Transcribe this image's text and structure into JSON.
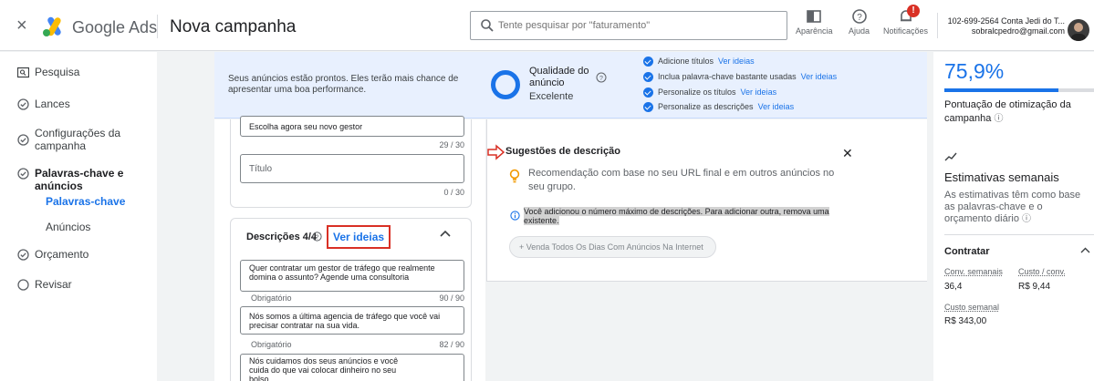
{
  "topbar": {
    "brand": "Google Ads",
    "page_title": "Nova campanha",
    "search_placeholder": "Tente pesquisar por \"faturamento\"",
    "tools": [
      "Aparência",
      "Ajuda",
      "Notificações"
    ],
    "notification_count": "!",
    "account_id": "102-699-2564 Conta Jedi do T...",
    "account_email": "sobralcpedro@gmail.com"
  },
  "nav": {
    "items": [
      "Pesquisa",
      "Lances",
      "Configurações da campanha",
      "Palavras-chave e anúncios",
      "Orçamento",
      "Revisar"
    ],
    "subitems": [
      "Palavras-chave",
      "Anúncios"
    ]
  },
  "banner": {
    "message": "Seus anúncios estão prontos. Eles terão mais chance de apresentar uma boa performance.",
    "quality_label": "Qualidade do anúncio",
    "quality_value": "Excelente",
    "checklist": [
      {
        "text": "Adicione títulos",
        "link": "Ver ideias"
      },
      {
        "text": "Inclua palavra-chave bastante usadas",
        "link": "Ver ideias"
      },
      {
        "text": "Personalize os títulos",
        "link": "Ver ideias"
      },
      {
        "text": "Personalize as descrições",
        "link": "Ver ideias"
      }
    ]
  },
  "editor": {
    "headline_value": "Escolha agora seu novo gestor",
    "headline_count": "29 / 30",
    "headline_placeholder": "Título",
    "empty_count": "0 / 30",
    "descriptions_title": "Descrições 4/4",
    "see_ideas": "Ver ideias",
    "required_label": "Obrigatório",
    "descriptions": [
      {
        "text": "Quer contratar um gestor de tráfego que realmente domina o assunto? Agende uma consultoria",
        "count": "90 / 90"
      },
      {
        "text": "Nós somos a última agencia de tráfego que você vai precisar contratar na sua vida.",
        "count": "82 / 90"
      },
      {
        "text": "Nós cuidamos dos seus anúncios e você cuida do que vai colocar dinheiro no seu bolso.",
        "count": ""
      }
    ]
  },
  "suggestions": {
    "title": "Sugestões de descrição",
    "recommendation": "Recomendação com base no seu URL final e em outros anúncios no seu grupo.",
    "warning": "Você adicionou o número máximo de descrições. Para adicionar outra, remova uma existente.",
    "chip": "+ Venda Todos Os Dias Com Anúncios Na Internet"
  },
  "optimization": {
    "score_text": "75,9%",
    "score_fraction": 0.759,
    "score_label": "Pontuação de otimização da campanha",
    "estimates_title": "Estimativas semanais",
    "estimates_desc": "As estimativas têm como base as palavras-chave e o orçamento diário",
    "section": "Contratar",
    "metrics": [
      {
        "label": "Conv. semanais",
        "value": "36,4"
      },
      {
        "label": "Custo / conv.",
        "value": "R$ 9,44"
      },
      {
        "label": "Custo semanal",
        "value": "R$ 343,00"
      }
    ]
  },
  "colors": {
    "accent": "#1a73e8",
    "alert": "#d93025",
    "banner": "#e8f0fe"
  }
}
